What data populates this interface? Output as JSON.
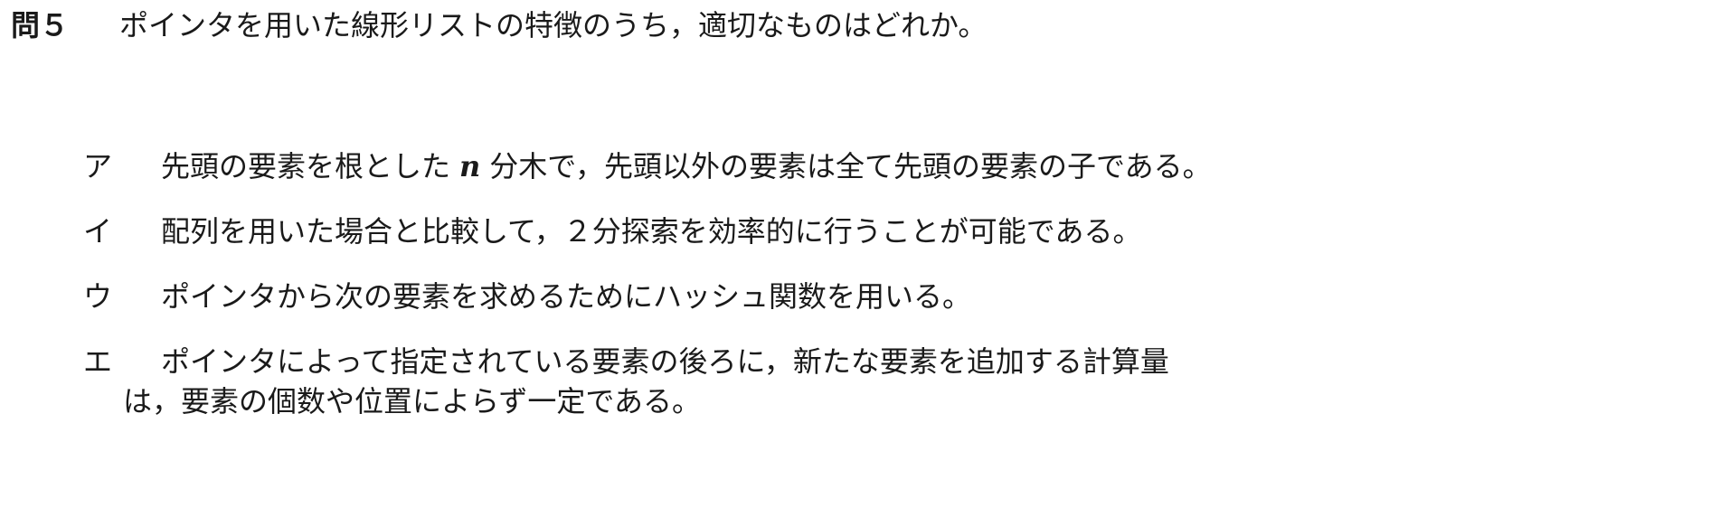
{
  "question": {
    "number": "問５",
    "text": "ポインタを用いた線形リストの特徴のうち，適切なものはどれか。"
  },
  "choices": [
    {
      "label": "ア",
      "text_before": "先頭の要素を根とした",
      "variable": "n",
      "text_after": "分木で，先頭以外の要素は全て先頭の要素の子である。"
    },
    {
      "label": "イ",
      "text": "配列を用いた場合と比較して，２分探索を効率的に行うことが可能である。"
    },
    {
      "label": "ウ",
      "text": "ポインタから次の要素を求めるためにハッシュ関数を用いる。"
    },
    {
      "label": "エ",
      "text": "ポインタによって指定されている要素の後ろに，新たな要素を追加する計算量",
      "continuation": "は，要素の個数や位置によらず一定である。"
    }
  ]
}
